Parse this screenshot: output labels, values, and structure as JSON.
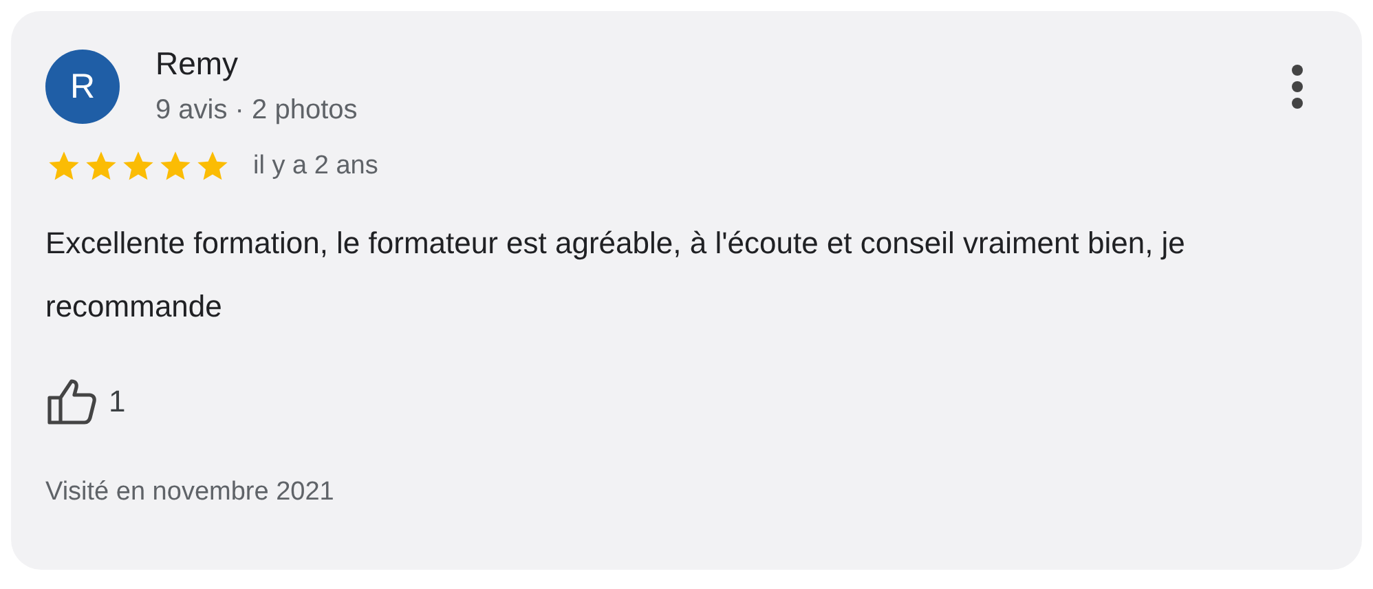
{
  "review": {
    "avatar_letter": "R",
    "author": "Remy",
    "author_meta": "9 avis · 2 photos",
    "stars": 5,
    "time": "il y a 2 ans",
    "text": "Excellente formation, le formateur est agréable, à l'écoute et conseil vraiment bien, je recommande",
    "likes": "1",
    "visited": "Visité en novembre 2021"
  }
}
